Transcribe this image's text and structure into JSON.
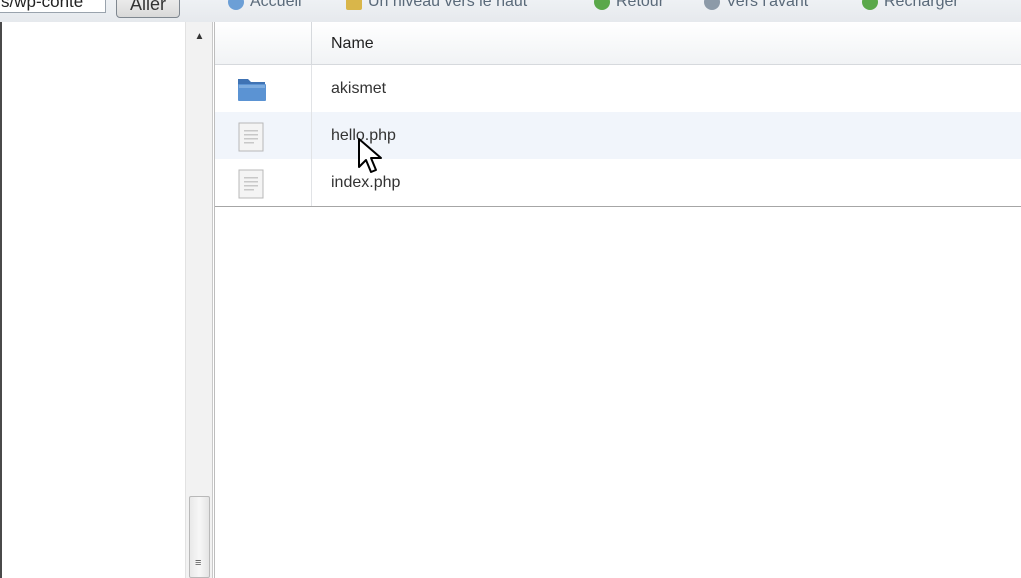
{
  "toolbar": {
    "path_value": "s/wp-conte",
    "go_label": "Aller",
    "items": [
      {
        "label": "Accueil",
        "icon": "home-icon"
      },
      {
        "label": "Un niveau vers le haut",
        "icon": "folder-up-icon"
      },
      {
        "label": "Retour",
        "icon": "back-arrow-icon"
      },
      {
        "label": "Vers l'avant",
        "icon": "forward-arrow-icon"
      },
      {
        "label": "Recharger",
        "icon": "reload-icon"
      }
    ]
  },
  "file_list": {
    "column_header": "Name",
    "rows": [
      {
        "name": "akismet",
        "type": "folder",
        "icon": "folder-icon"
      },
      {
        "name": "hello.php",
        "type": "file",
        "icon": "file-icon",
        "hovered": true
      },
      {
        "name": "index.php",
        "type": "file",
        "icon": "file-icon"
      }
    ]
  },
  "colors": {
    "folder_blue": "#4f86c6",
    "hover_row": "#f1f5fb",
    "header_bg": "#f1f3f5"
  }
}
